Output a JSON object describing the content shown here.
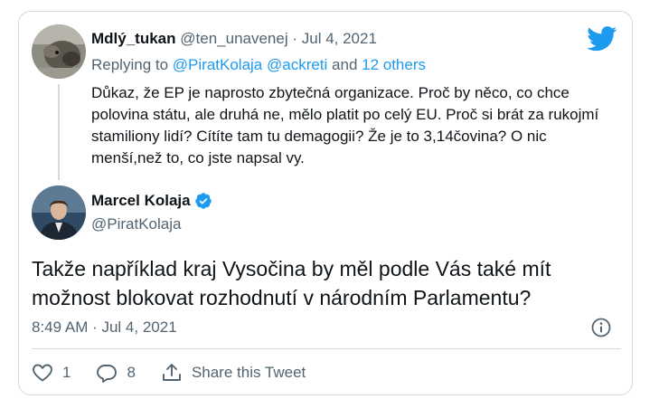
{
  "parent_tweet": {
    "display_name": "Mdlý_tukan",
    "handle": "@ten_unavenej",
    "separator": " · ",
    "date": "Jul 4, 2021",
    "replying_label": "Replying to ",
    "replying_to_user": "@PiratKolaja",
    "replying_to_second": "@ackreti",
    "replying_and": " and ",
    "replying_others": "12 others",
    "text": "Důkaz, že EP je naprosto zbytečná organizace. Proč by něco, co chce polovina státu, ale druhá ne, mělo platit po celý EU. Proč si brát za rukojmí stamiliony lidí? Cítíte tam tu demagogii? Že je to 3,14čovina? O nic menší,než to, co jste napsal vy."
  },
  "main_tweet": {
    "display_name": "Marcel Kolaja",
    "handle": "@PiratKolaja",
    "text": "Takže například kraj Vysočina by měl podle Vás také mít možnost blokovat rozhodnutí v národním Parlamentu?",
    "timestamp": "8:49 AM · Jul 4, 2021"
  },
  "actions": {
    "like_count": "1",
    "reply_count": "8",
    "share_label": "Share this Tweet"
  },
  "colors": {
    "twitter_blue": "#1d9bf0",
    "muted_text": "#536471",
    "border": "#cfd9de"
  },
  "icons": [
    "twitter-bird-icon",
    "verified-badge-icon",
    "info-icon",
    "heart-icon",
    "reply-bubble-icon",
    "share-icon"
  ]
}
